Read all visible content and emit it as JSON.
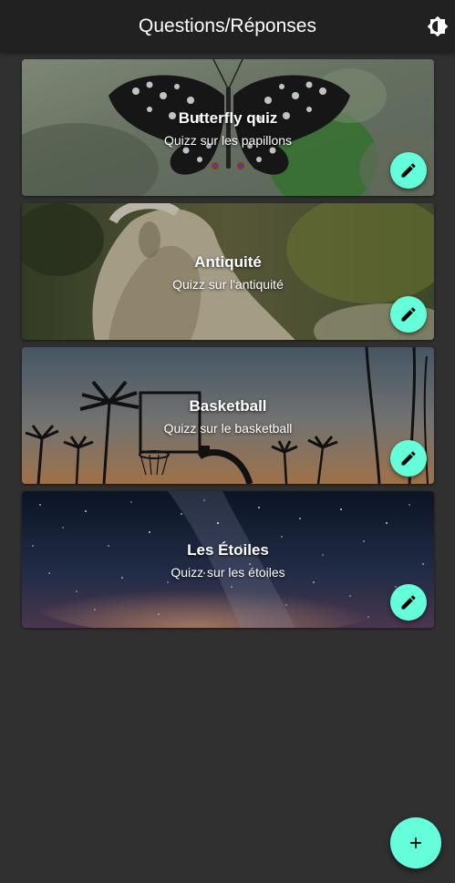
{
  "app": {
    "title": "Questions/Réponses",
    "theme_icon": "brightness-icon"
  },
  "quizzes": [
    {
      "title": "Butterfly quiz",
      "subtitle": "Quizz sur les papillons",
      "image": "butterfly-photo"
    },
    {
      "title": "Antiquité",
      "subtitle": "Quizz sur l'antiquité",
      "image": "statue-photo"
    },
    {
      "title": "Basketball",
      "subtitle": "Quizz sur le basketball",
      "image": "basketball-hoop-photo"
    },
    {
      "title": "Les Étoiles",
      "subtitle": "Quizz sur les étoiles",
      "image": "milky-way-photo"
    }
  ],
  "actions": {
    "edit_icon": "pencil-icon",
    "add_icon": "plus-icon"
  },
  "colors": {
    "app_bar": "#212121",
    "background": "#303030",
    "accent": "#64ffda",
    "text": "#ffffff"
  }
}
